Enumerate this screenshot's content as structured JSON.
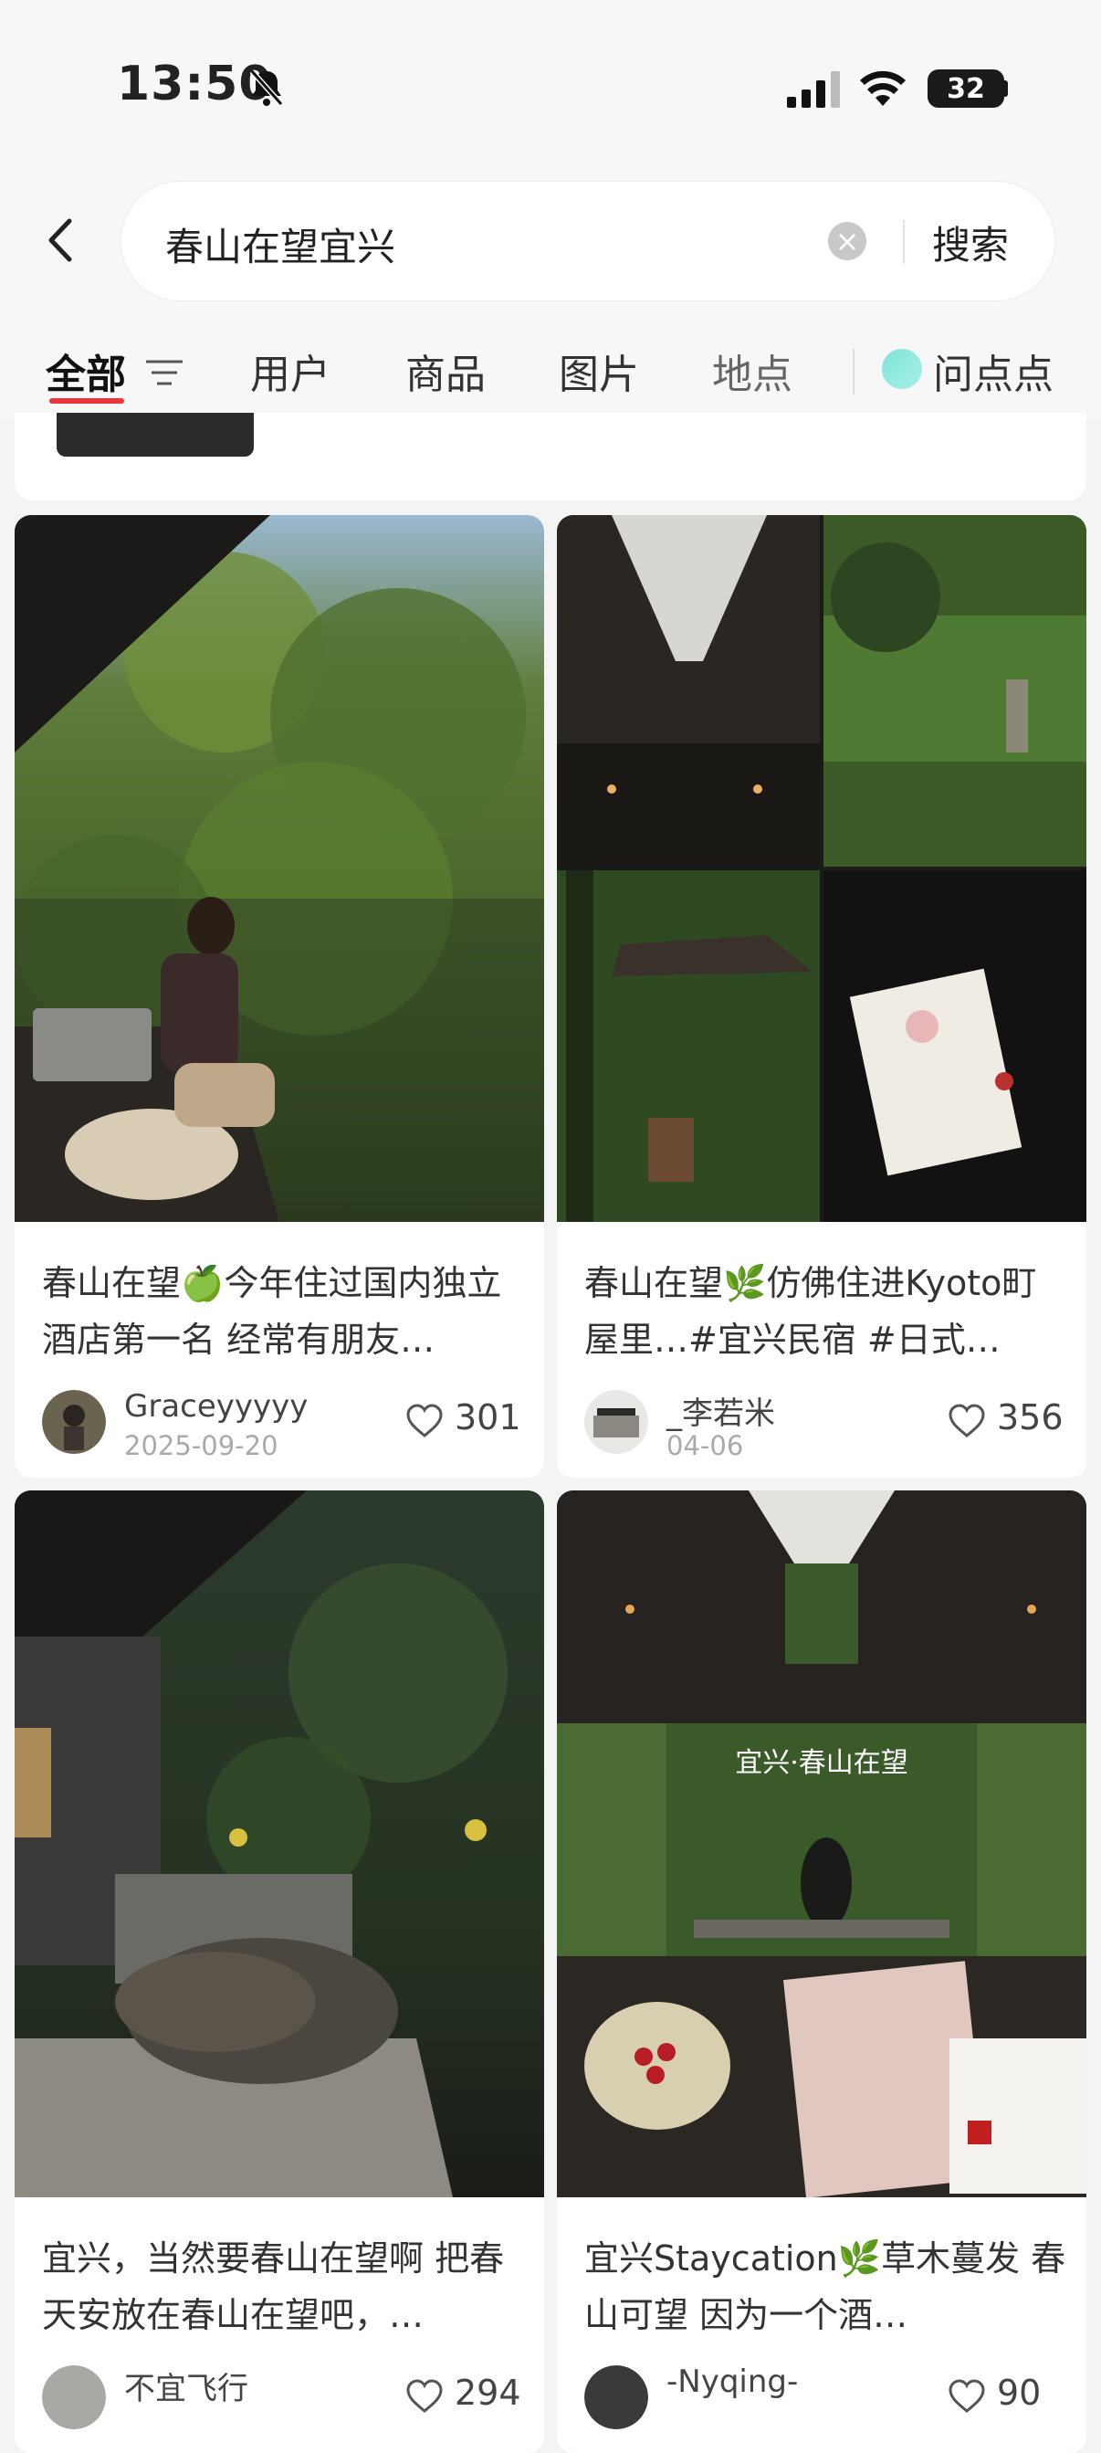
{
  "status": {
    "time": "13:50",
    "battery": "32"
  },
  "search": {
    "query": "春山在望宜兴",
    "button": "搜索"
  },
  "tabs": [
    {
      "label": "全部"
    },
    {
      "label": "用户"
    },
    {
      "label": "商品"
    },
    {
      "label": "图片"
    },
    {
      "label": "地点"
    },
    {
      "label": "问点点"
    }
  ],
  "posts": [
    {
      "title": "春山在望🍏今年住过国内独立酒店第一名 经常有朋友…",
      "author": "Graceyyyyy",
      "date": "2025-09-20",
      "likes": "301"
    },
    {
      "title": "春山在望🌿仿佛住进Kyoto町屋里…#宜兴民宿 #日式…",
      "author": "_李若米",
      "date": "04-06",
      "likes": "356"
    },
    {
      "title": "宜兴，当然要春山在望啊 把春天安放在春山在望吧，…",
      "author": "不宜飞行",
      "date": "",
      "likes": "294"
    },
    {
      "title": "宜兴Staycation🌿草木蔓发 春山可望 因为一个酒…",
      "author": "-Nyqing-",
      "date": "",
      "likes": "90"
    }
  ],
  "photo_overlay_text": "宜兴·春山在望"
}
